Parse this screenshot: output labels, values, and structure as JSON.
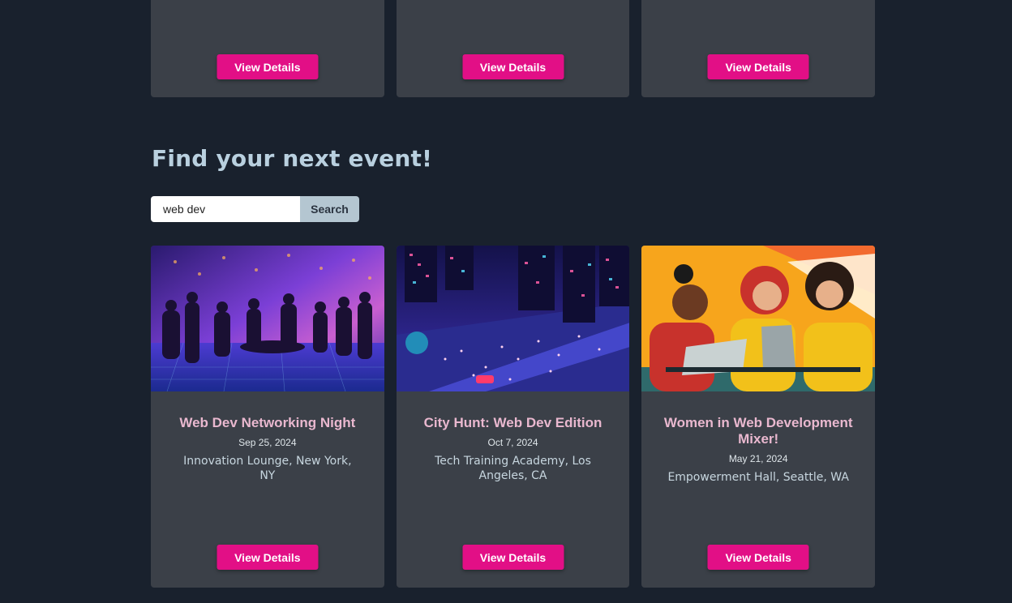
{
  "top_cards": [
    {
      "button_label": "View Details"
    },
    {
      "button_label": "View Details"
    },
    {
      "button_label": "View Details"
    }
  ],
  "section": {
    "title": "Find your next event!"
  },
  "search": {
    "value": "web dev",
    "button_label": "Search"
  },
  "events": [
    {
      "image_icon": "networking-night-illustration",
      "title": "Web Dev Networking Night",
      "date": "Sep 25, 2024",
      "location": "Innovation Lounge, New York, NY",
      "button_label": "View Details"
    },
    {
      "image_icon": "city-street-illustration",
      "title": "City Hunt: Web Dev Edition",
      "date": "Oct 7, 2024",
      "location": "Tech Training Academy, Los Angeles, CA",
      "button_label": "View Details"
    },
    {
      "image_icon": "women-laptops-illustration",
      "title": "Women in Web Development Mixer!",
      "date": "May 21, 2024",
      "location": "Empowerment Hall, Seattle, WA",
      "button_label": "View Details"
    }
  ],
  "colors": {
    "background": "#19212d",
    "card": "#3b4048",
    "accent": "#e20f86",
    "title_text": "#b9d0df",
    "event_title": "#e9b8cf",
    "search_button": "#b4c6d1"
  }
}
